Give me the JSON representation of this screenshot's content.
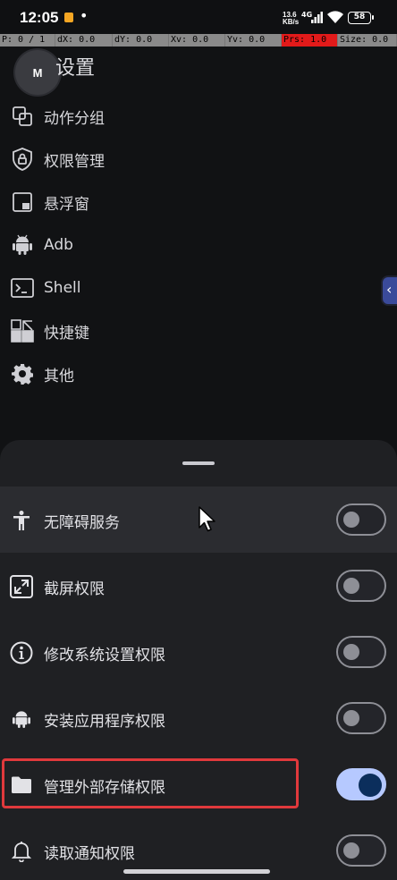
{
  "status_bar": {
    "time": "12:05",
    "more_dots": "•",
    "net_speed_value": "13.6",
    "net_speed_unit": "KB/s",
    "network": "4G",
    "battery": "58"
  },
  "debug_bar": {
    "p": "P: 0 / 1",
    "dx": "dX: 0.0",
    "dy": "dY: 0.0",
    "xv": "Xv: 0.0",
    "yv": "Yv: 0.0",
    "prs": "Prs: 1.0",
    "size": "Size: 0.0"
  },
  "header": {
    "avatar_letter": "M",
    "title": "设置"
  },
  "menu": [
    {
      "label": "动作分组",
      "icon": "copy-squares-icon"
    },
    {
      "label": "权限管理",
      "icon": "shield-lock-icon"
    },
    {
      "label": "悬浮窗",
      "icon": "floating-window-icon"
    },
    {
      "label": "Adb",
      "icon": "android-icon"
    },
    {
      "label": "Shell",
      "icon": "terminal-icon"
    },
    {
      "label": "快捷键",
      "icon": "shortcut-icon"
    },
    {
      "label": "其他",
      "icon": "gear-icon"
    }
  ],
  "permissions": [
    {
      "label": "无障碍服务",
      "icon": "accessibility-icon",
      "enabled": false
    },
    {
      "label": "截屏权限",
      "icon": "screenshot-expand-icon",
      "enabled": false
    },
    {
      "label": "修改系统设置权限",
      "icon": "info-icon",
      "enabled": false
    },
    {
      "label": "安装应用程序权限",
      "icon": "android-icon",
      "enabled": false
    },
    {
      "label": "管理外部存储权限",
      "icon": "folder-icon",
      "enabled": true
    },
    {
      "label": "读取通知权限",
      "icon": "bell-icon",
      "enabled": false
    }
  ],
  "colors": {
    "toggle_on_track": "#b6c9ff",
    "toggle_on_knob": "#0b2e5c",
    "highlight_box": "#e0393c",
    "pressure_cell": "#e21a1a"
  }
}
